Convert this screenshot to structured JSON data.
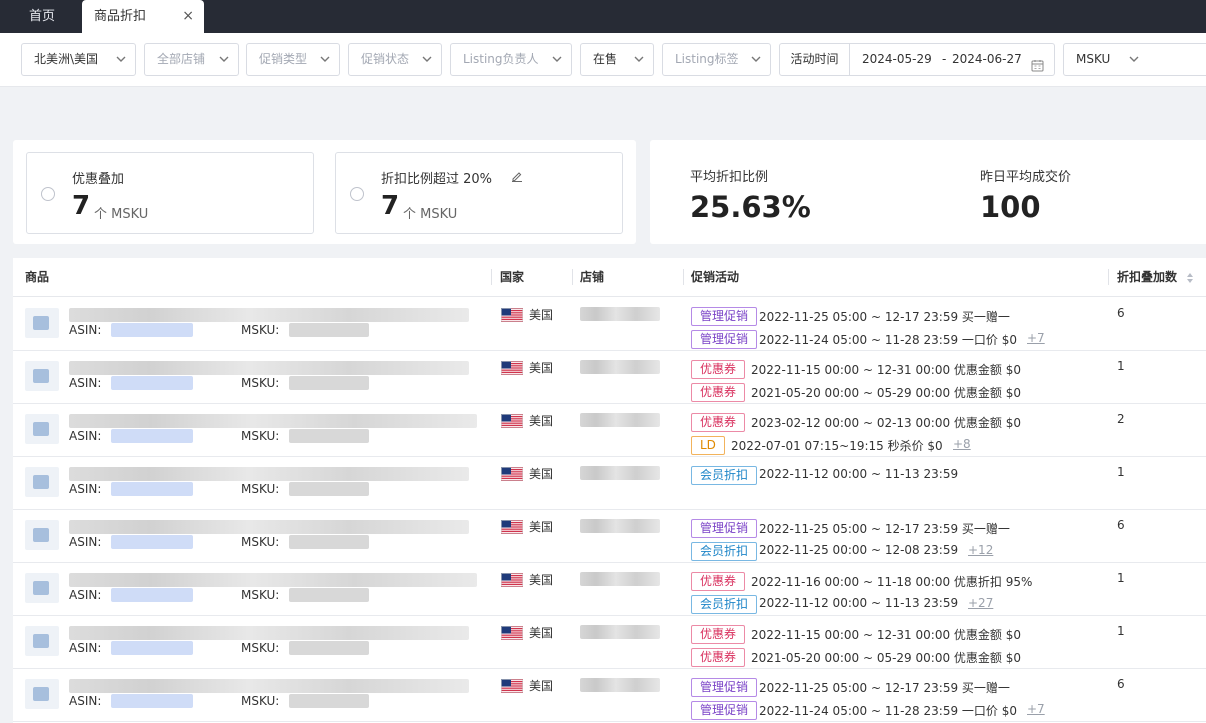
{
  "tabs": {
    "home": "首页",
    "active": "商品折扣",
    "close": "×"
  },
  "filters": {
    "region": "北美洲\\美国",
    "shops": "全部店铺",
    "promo_type": "促销类型",
    "promo_status": "促销状态",
    "listing_owner": "Listing负责人",
    "sale_status": "在售",
    "listing_tag": "Listing标签",
    "time_label": "活动时间",
    "date_start": "2024-05-29",
    "date_sep": "-",
    "date_end": "2024-06-27",
    "msku_select": "MSKU"
  },
  "stats": {
    "stack": {
      "title": "优惠叠加",
      "count": "7",
      "unit": "个 MSKU"
    },
    "over": {
      "title": "折扣比例超过 20%",
      "count": "7",
      "unit": "个 MSKU"
    },
    "avg_discount": {
      "label": "平均折扣比例",
      "value": "25.63%"
    },
    "avg_price": {
      "label": "昨日平均成交价",
      "value": "100"
    }
  },
  "table": {
    "headers": {
      "product": "商品",
      "country": "国家",
      "shop": "店铺",
      "promo": "促销活动",
      "stack": "折扣叠加数"
    },
    "asin_label": "ASIN:",
    "msku_label": "MSKU:",
    "rows": [
      {
        "country": "美国",
        "count": "6",
        "more": "+7",
        "promos": [
          {
            "tag": "管理促销",
            "kind": "mg",
            "text": "2022-11-25 05:00 ~ 12-17 23:59 买一赠一"
          },
          {
            "tag": "管理促销",
            "kind": "mg",
            "text": "2022-11-24 05:00 ~ 11-28 23:59 一口价 $0"
          }
        ]
      },
      {
        "country": "美国",
        "count": "1",
        "more": "",
        "promos": [
          {
            "tag": "优惠券",
            "kind": "yh",
            "text": "2022-11-15 00:00 ~ 12-31 00:00 优惠金额 $0"
          },
          {
            "tag": "优惠券",
            "kind": "yh",
            "text": "2021-05-20 00:00 ~ 05-29 00:00 优惠金额 $0"
          }
        ]
      },
      {
        "country": "美国",
        "count": "2",
        "more": "+8",
        "promos": [
          {
            "tag": "优惠券",
            "kind": "yh",
            "text": "2023-02-12 00:00 ~ 02-13 00:00 优惠金额 $0"
          },
          {
            "tag": "LD",
            "kind": "ld",
            "text": "2022-07-01 07:15~19:15 秒杀价 $0"
          }
        ]
      },
      {
        "country": "美国",
        "count": "1",
        "more": "",
        "promos": [
          {
            "tag": "会员折扣",
            "kind": "hy",
            "text": "2022-11-12 00:00 ~ 11-13 23:59"
          }
        ]
      },
      {
        "country": "美国",
        "count": "6",
        "more": "+12",
        "promos": [
          {
            "tag": "管理促销",
            "kind": "mg",
            "text": "2022-11-25 05:00 ~ 12-17 23:59 买一赠一"
          },
          {
            "tag": "会员折扣",
            "kind": "hy",
            "text": "2022-11-25 00:00 ~ 12-08 23:59"
          }
        ]
      },
      {
        "country": "美国",
        "count": "1",
        "more": "+27",
        "promos": [
          {
            "tag": "优惠券",
            "kind": "yh",
            "text": "2022-11-16 00:00 ~ 11-18 00:00 优惠折扣 95%"
          },
          {
            "tag": "会员折扣",
            "kind": "hy",
            "text": "2022-11-12 00:00 ~ 11-13 23:59"
          }
        ]
      },
      {
        "country": "美国",
        "count": "1",
        "more": "",
        "promos": [
          {
            "tag": "优惠券",
            "kind": "yh",
            "text": "2022-11-15 00:00 ~ 12-31 00:00 优惠金额 $0"
          },
          {
            "tag": "优惠券",
            "kind": "yh",
            "text": "2021-05-20 00:00 ~ 05-29 00:00 优惠金额 $0"
          }
        ]
      },
      {
        "country": "美国",
        "count": "6",
        "more": "+7",
        "promos": [
          {
            "tag": "管理促销",
            "kind": "mg",
            "text": "2022-11-25 05:00 ~ 12-17 23:59 买一赠一"
          },
          {
            "tag": "管理促销",
            "kind": "mg",
            "text": "2022-11-24 05:00 ~ 11-28 23:59 一口价 $0"
          }
        ]
      }
    ]
  }
}
